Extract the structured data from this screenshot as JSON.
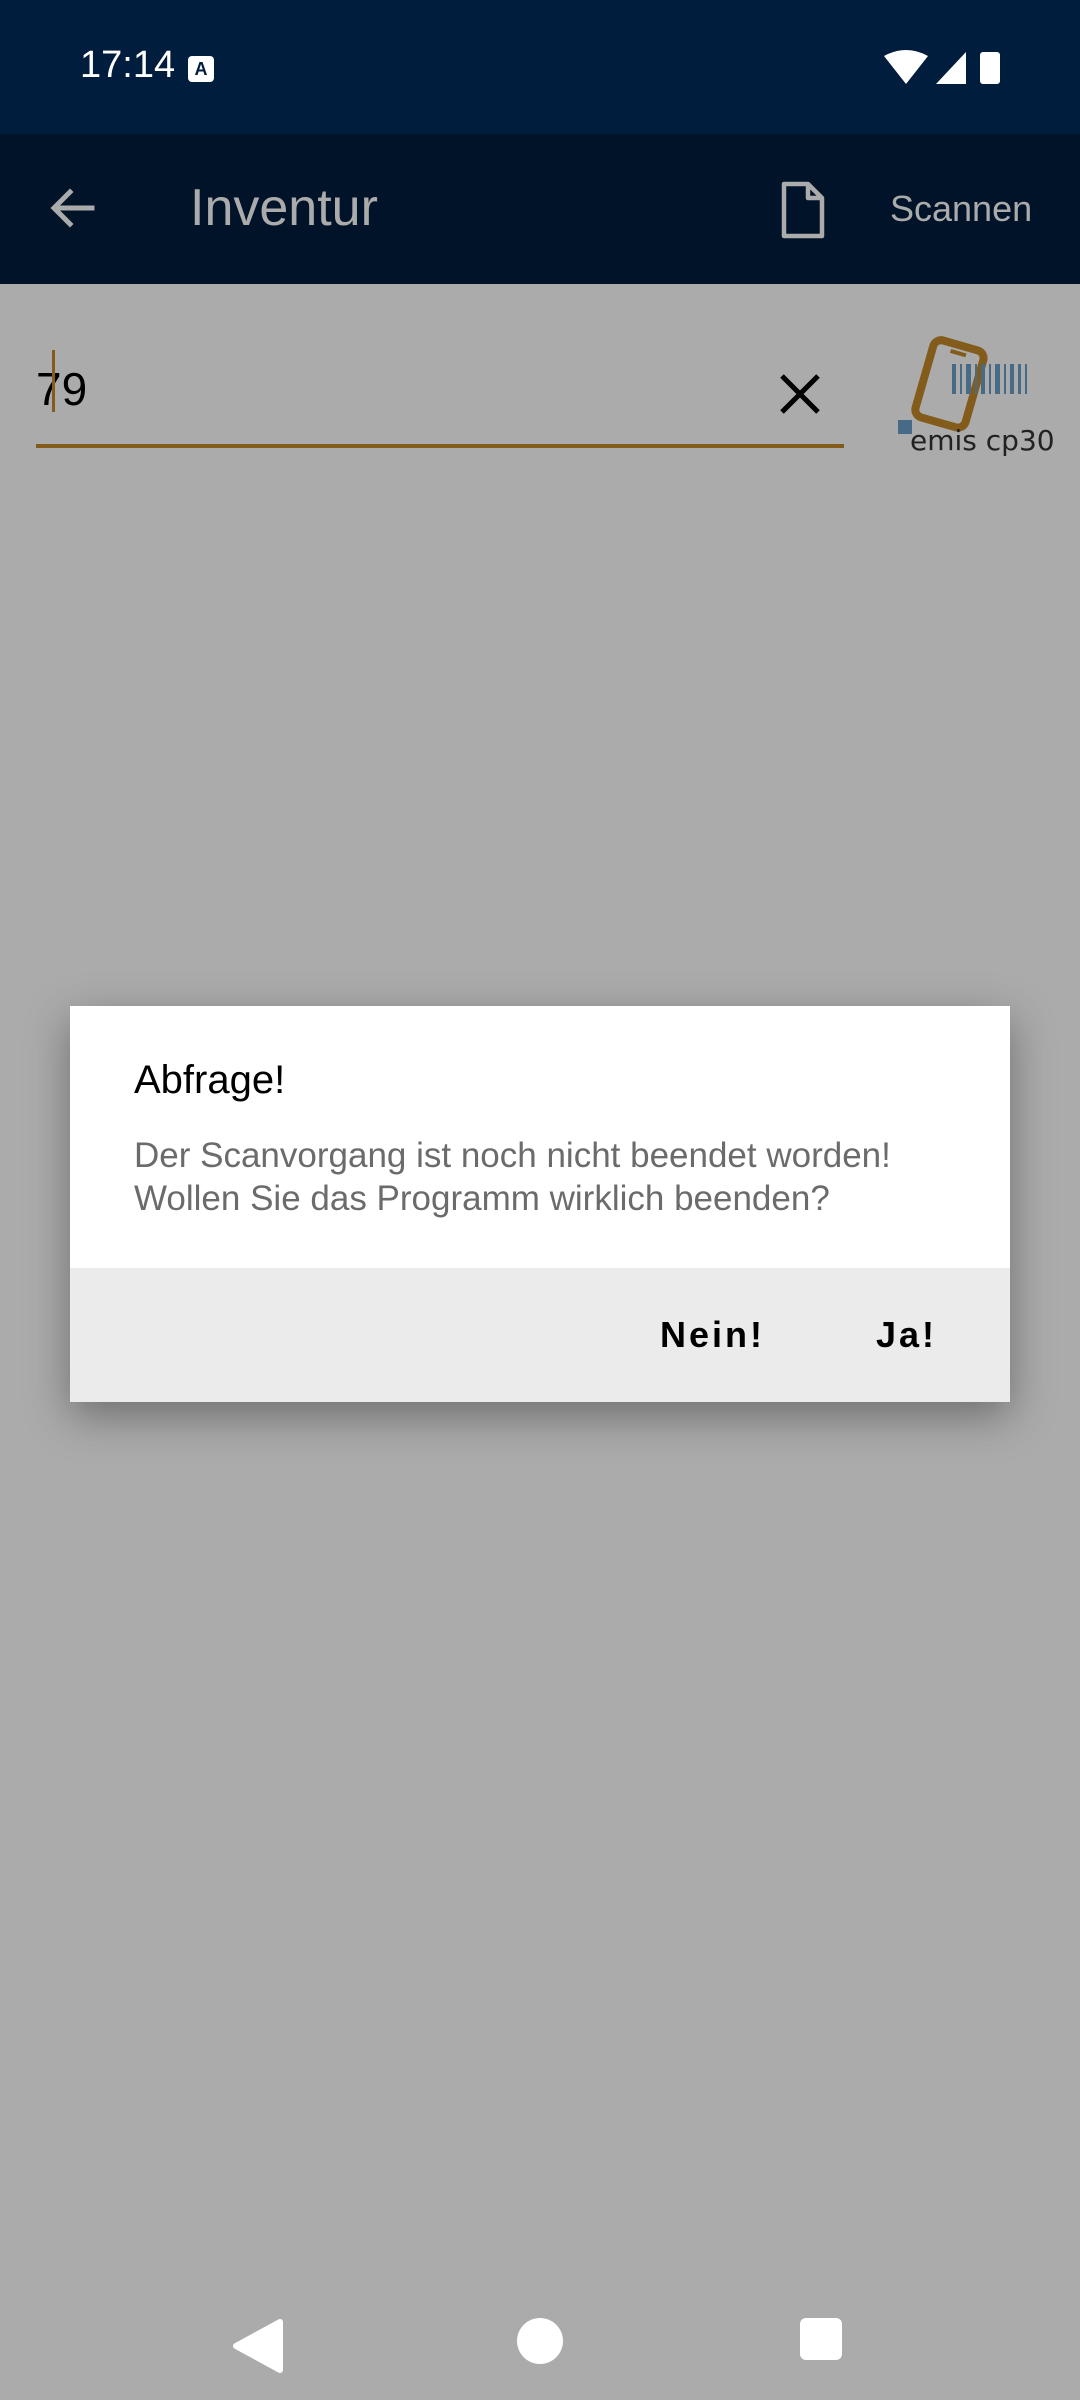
{
  "status_bar": {
    "time": "17:14",
    "notification_icon": "A",
    "icons": [
      "wifi-icon",
      "signal-icon",
      "battery-icon"
    ]
  },
  "app_bar": {
    "title": "Inventur",
    "scan_label": "Scannen",
    "back_icon": "arrow-left-icon",
    "document_icon": "document-icon"
  },
  "search": {
    "value": "79",
    "clear_icon": "close-icon"
  },
  "logo": {
    "text": "emis cp30",
    "accent": "#c4892a",
    "barcode_color": "#6a9ec8"
  },
  "dialog": {
    "title": "Abfrage!",
    "message": "Der Scanvorgang ist noch nicht beendet worden!\nWollen Sie das Programm wirklich beenden?",
    "cancel_label": "Nein!",
    "confirm_label": "Ja!"
  },
  "nav_bar": {
    "icons": [
      "back-triangle-icon",
      "home-circle-icon",
      "recents-square-icon"
    ]
  },
  "colors": {
    "app_bar": "#001d3d",
    "accent": "#c4892a",
    "dialog_actions_bg": "#ebebeb"
  }
}
